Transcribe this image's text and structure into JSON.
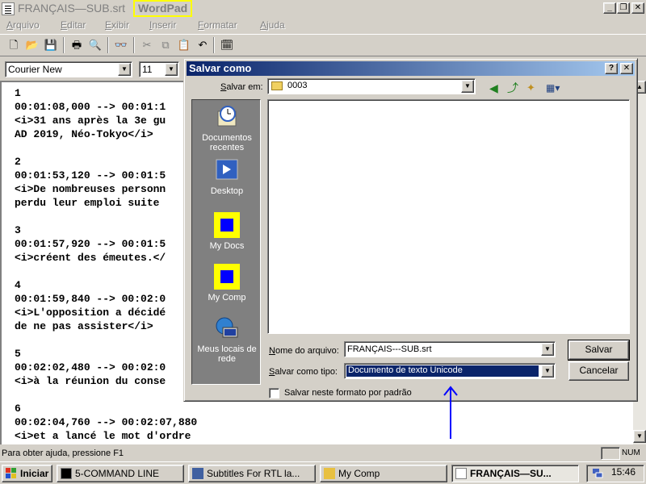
{
  "window": {
    "doc_title": "FRANÇAIS—SUB.srt",
    "app_title": "WordPad",
    "separator": " - "
  },
  "menu": [
    "Arquivo",
    "Editar",
    "Exibir",
    "Inserir",
    "Formatar",
    "Ajuda"
  ],
  "toolbar_icons": [
    "new-icon",
    "open-icon",
    "save-icon",
    "print-icon",
    "print-preview-icon",
    "find-icon",
    "cut-icon",
    "copy-icon",
    "paste-icon",
    "undo-icon",
    "date-time-icon"
  ],
  "format": {
    "font": "Courier New",
    "size": "11"
  },
  "document": {
    "lines": [
      "1",
      "00:01:08,000 --> 00:01:1",
      "<i>31 ans après la 3e gu",
      "AD 2019, Néo-Tokyo</i>",
      "",
      "2",
      "00:01:53,120 --> 00:01:5",
      "<i>De nombreuses personn",
      "perdu leur emploi suite",
      "",
      "3",
      "00:01:57,920 --> 00:01:5",
      "<i>créent des émeutes.</",
      "",
      "4",
      "00:01:59,840 --> 00:02:0",
      "<i>L'opposition a décidé",
      "de ne pas assister</i>",
      "",
      "5",
      "00:02:02,480 --> 00:02:0",
      "<i>à la réunion du conse",
      "",
      "6",
      "00:02:04,760 --> 00:02:07,880",
      "<i>et a lancé le mot d'ordre"
    ]
  },
  "status": {
    "help": "Para obter ajuda, pressione F1",
    "num": "NUM"
  },
  "taskbar": {
    "start": "Iniciar",
    "tasks": [
      "5-COMMAND LINE",
      "Subtitles For RTL la...",
      "My Comp",
      "FRANÇAIS—SU..."
    ],
    "clock": "15:46"
  },
  "dialog": {
    "title": "Salvar como",
    "save_in_label": "Salvar em:",
    "save_in_value": "0003",
    "places": [
      "Documentos recentes",
      "Desktop",
      "My Docs",
      "My Comp",
      "Meus locais de rede"
    ],
    "filename_label": "Nome do arquivo:",
    "filename_value": "FRANÇAIS---SUB.srt",
    "filetype_label": "Salvar como tipo:",
    "filetype_value": "Documento de texto Unicode",
    "save_button": "Salvar",
    "cancel_button": "Cancelar",
    "default_format_checkbox": "Salvar neste formato por padrão",
    "help_button": "?",
    "close_button": "✕"
  },
  "colors": {
    "title_highlight": "#ffff00",
    "dialog_title_start": "#0a246a",
    "dialog_title_end": "#a6caf0",
    "selection": "#0a246a",
    "annotation_arrow": "#0000ff",
    "places_square": "#0000ff",
    "places_square_border": "#ffff00"
  }
}
